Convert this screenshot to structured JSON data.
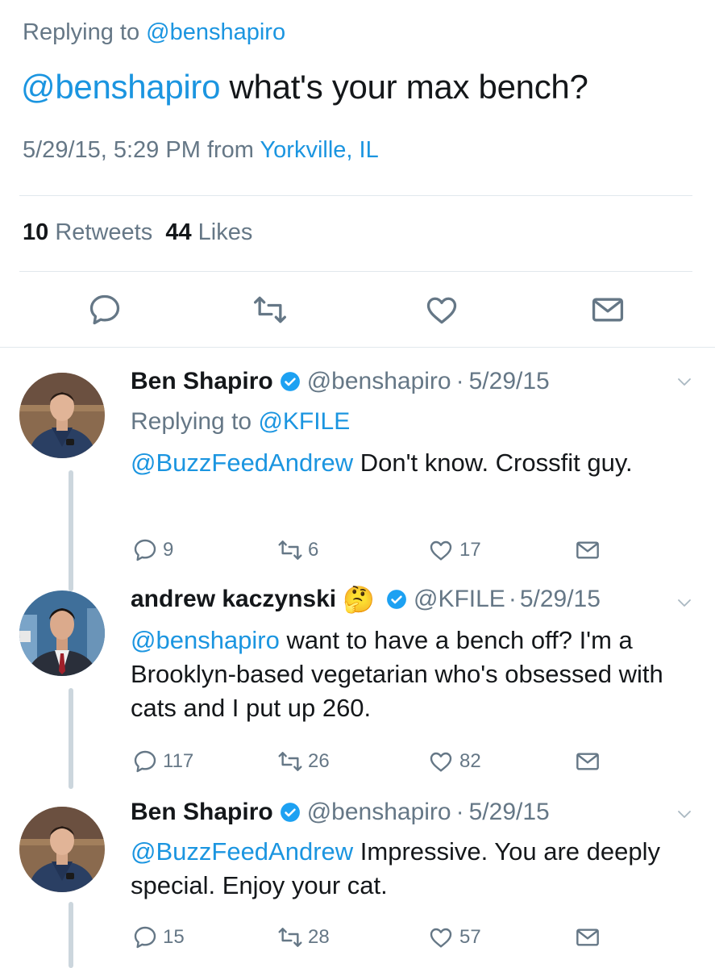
{
  "main_tweet": {
    "replying_label": "Replying to",
    "replying_handle": "@benshapiro",
    "text_mention": "@benshapiro",
    "text_body": " what's your max bench?",
    "timestamp": "5/29/15, 5:29 PM",
    "from_label": "from",
    "location": "Yorkville, IL",
    "retweets_count": "10",
    "retweets_label": "Retweets",
    "likes_count": "44",
    "likes_label": "Likes"
  },
  "replies": [
    {
      "name": "Ben Shapiro",
      "handle": "@benshapiro",
      "dot": "·",
      "date": "5/29/15",
      "replying_label": "Replying to",
      "replying_handle": "@KFILE",
      "mention": "@BuzzFeedAndrew",
      "text": " Don't know. Crossfit guy.",
      "replies": "9",
      "retweets": "6",
      "likes": "17"
    },
    {
      "name": "andrew kaczynski",
      "emoji": "🤔",
      "handle": "@KFILE",
      "dot": "·",
      "date": "5/29/15",
      "mention": "@benshapiro",
      "text": " want to have a bench off? I'm a Brooklyn-based vegetarian who's obsessed with cats and I put up 260.",
      "replies": "117",
      "retweets": "26",
      "likes": "82"
    },
    {
      "name": "Ben Shapiro",
      "handle": "@benshapiro",
      "dot": "·",
      "date": "5/29/15",
      "mention": "@BuzzFeedAndrew",
      "text": " Impressive. You are deeply special. Enjoy your cat.",
      "replies": "15",
      "retweets": "28",
      "likes": "57"
    }
  ],
  "colors": {
    "link": "#1b95e0",
    "secondary_text": "#657786",
    "primary_text": "#14171a",
    "divider": "#e1e8ed",
    "thread_line": "#ccd6dd",
    "verified": "#1da1f2"
  }
}
